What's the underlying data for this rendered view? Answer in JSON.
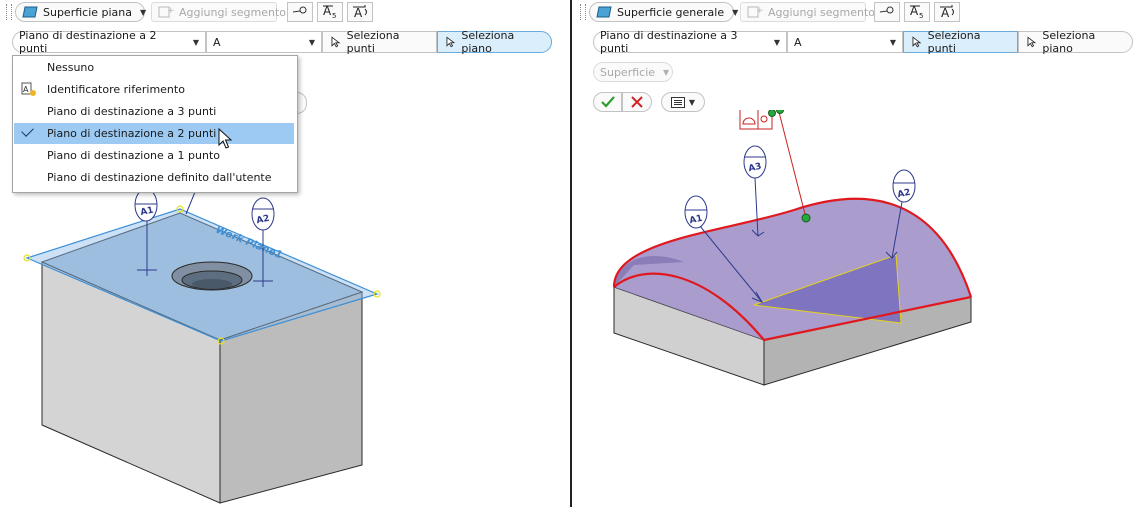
{
  "left": {
    "toolbar": {
      "surface_type": "Superficie piana",
      "add_segment": "Aggiungi segmento",
      "icons": [
        "surface-icon",
        "add-segment-icon",
        "detach-icon",
        "text-size-icon",
        "text-format-icon"
      ]
    },
    "options": {
      "destination_combo": "Piano di destinazione a 2 punti",
      "reference_combo": "A",
      "select_points": "Seleziona punti",
      "select_plane": "Seleziona piano"
    },
    "menu": {
      "items": [
        {
          "label": "Nessuno"
        },
        {
          "label": "Identificatore riferimento"
        },
        {
          "label": "Piano di destinazione a 3 punti"
        },
        {
          "label": "Piano di destinazione a 2 punti",
          "selected": true
        },
        {
          "label": "Piano di destinazione a 1 punto"
        },
        {
          "label": "Piano di destinazione definito dall'utente"
        }
      ]
    },
    "viewport": {
      "targets": [
        "A1",
        "A2"
      ],
      "plane_text": "Work Plane1"
    }
  },
  "right": {
    "toolbar": {
      "surface_type": "Superficie generale",
      "add_segment": "Aggiungi segmento"
    },
    "options": {
      "destination_combo": "Piano di destinazione a 3 punti",
      "reference_combo": "A",
      "select_points": "Seleziona punti",
      "select_plane": "Seleziona piano"
    },
    "surface_dropdown": "Superficie",
    "viewport": {
      "targets": [
        "A1",
        "A2",
        "A3"
      ]
    }
  },
  "colors": {
    "accent": "#6aa9d8",
    "menu_selected": "#9ccaf2",
    "ok_green": "#2e9e2e",
    "cancel_red": "#d22222",
    "surface_edge": "#e0191f",
    "surface_fill": "#9b8cc6"
  }
}
